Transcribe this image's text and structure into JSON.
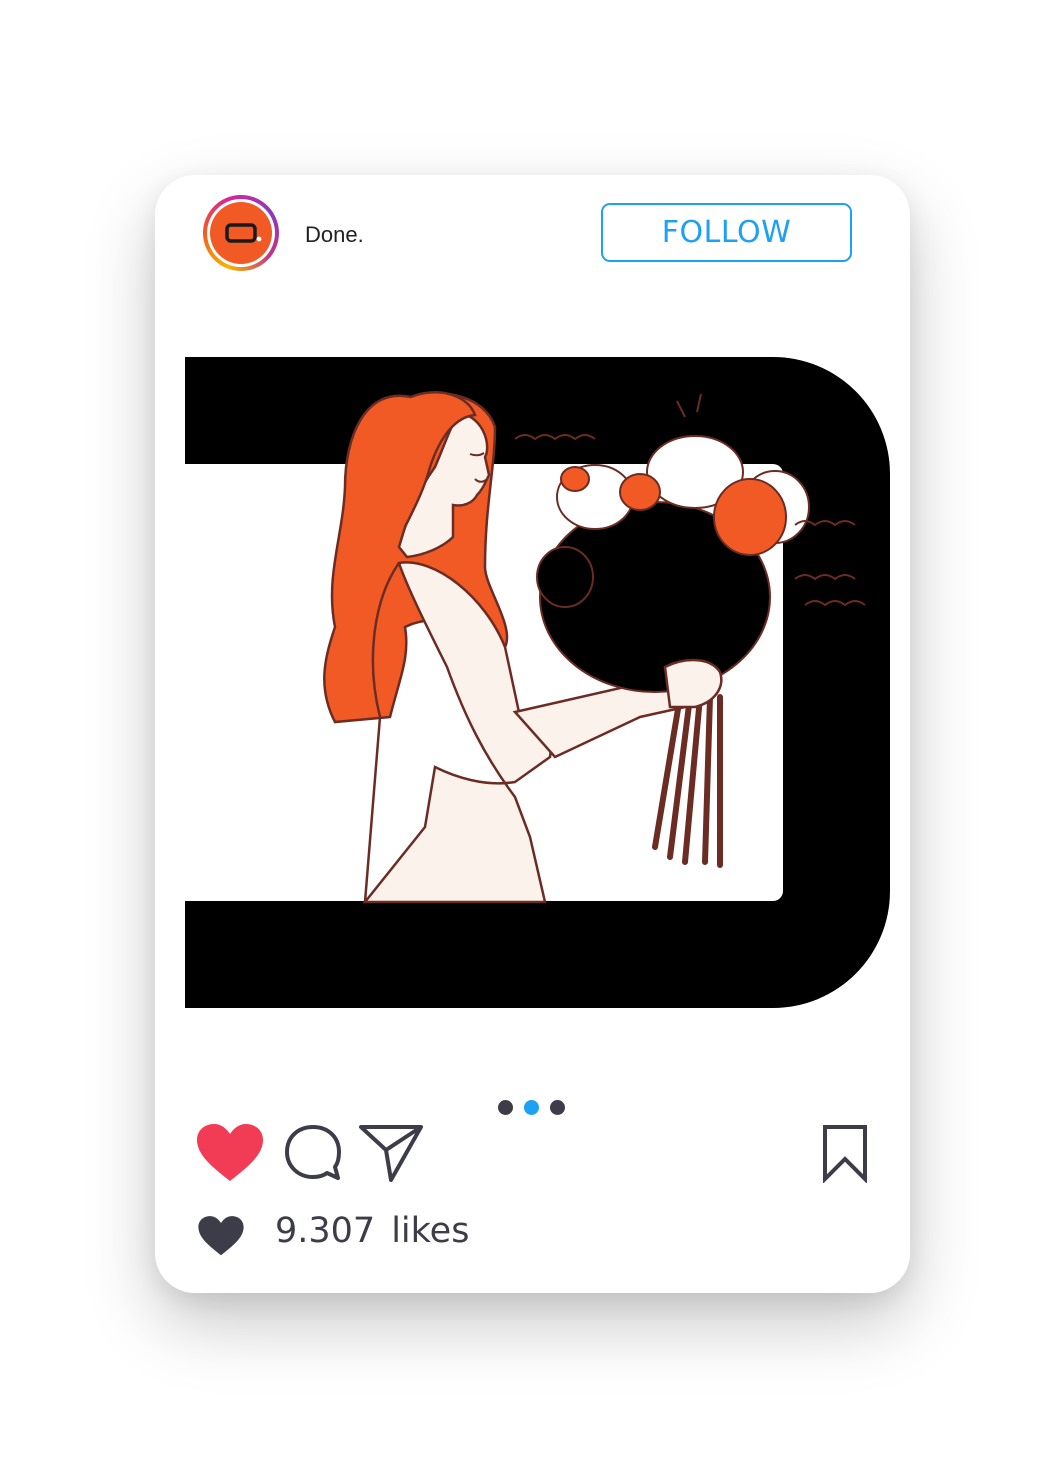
{
  "post": {
    "username": "Done.",
    "follow_label": "FOLLOW",
    "likes_count": "9.307",
    "likes_word": "likes",
    "carousel": {
      "total": 3,
      "active_index": 1
    },
    "liked": true
  },
  "icons": {
    "avatar": "done-logo-icon",
    "like": "heart-icon",
    "comment": "comment-icon",
    "share": "paper-plane-icon",
    "save": "bookmark-icon",
    "likes": "heart-icon"
  },
  "colors": {
    "follow_blue": "#1da1f2",
    "like_red": "#f23c55",
    "brand_orange": "#f15a24",
    "dot_active": "#1da1f2",
    "dot_inactive": "#3d3d4a",
    "icon_dark": "#3d3d4a"
  }
}
